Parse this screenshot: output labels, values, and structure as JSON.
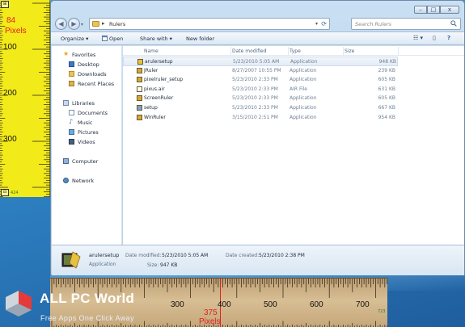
{
  "vertical_ruler": {
    "pixel_value": "84",
    "pixel_unit": "Pixels",
    "tick_labels": [
      "100",
      "200",
      "300"
    ],
    "bottom_readout": "424"
  },
  "window": {
    "address": {
      "path": "Rulers"
    },
    "search": {
      "placeholder": "Search Rulers"
    },
    "controls": {
      "minimize": "–",
      "maximize": "□",
      "close": "x"
    },
    "toolbar": {
      "organize": "Organize ▾",
      "open": "Open",
      "share_with": "Share with ▾",
      "new_folder": "New folder"
    },
    "nav_pane": {
      "favorites": "Favorites",
      "desktop": "Desktop",
      "downloads": "Downloads",
      "recent_places": "Recent Places",
      "libraries": "Libraries",
      "documents": "Documents",
      "music": "Music",
      "pictures": "Pictures",
      "videos": "Videos",
      "computer": "Computer",
      "network": "Network"
    },
    "columns": {
      "name": "Name",
      "date": "Date modified",
      "type": "Type",
      "size": "Size"
    },
    "files": [
      {
        "name": "arulersetup",
        "date": "5/23/2010 5:05 AM",
        "type": "Application",
        "size": "948 KB",
        "icon": "installer-icon"
      },
      {
        "name": "JRuler",
        "date": "8/27/2007 10:55 PM",
        "type": "Application",
        "size": "239 KB",
        "icon": "ruler-app-icon"
      },
      {
        "name": "pixelruler_setup",
        "date": "5/23/2010 2:33 PM",
        "type": "Application",
        "size": "605 KB",
        "icon": "ruler-app-icon"
      },
      {
        "name": "pixus.air",
        "date": "5/23/2010 2:33 PM",
        "type": "AIR File",
        "size": "631 KB",
        "icon": "air-file-icon"
      },
      {
        "name": "ScreenRuler",
        "date": "5/23/2010 2:33 PM",
        "type": "Application",
        "size": "605 KB",
        "icon": "ruler-app-icon"
      },
      {
        "name": "setup",
        "date": "5/23/2010 2:33 PM",
        "type": "Application",
        "size": "667 KB",
        "icon": "setup-icon"
      },
      {
        "name": "WinRuler",
        "date": "3/15/2010 2:51 PM",
        "type": "Application",
        "size": "954 KB",
        "icon": "ruler-app-icon"
      }
    ],
    "details": {
      "name": "arulersetup",
      "type": "Application",
      "modified_label": "Date modified:",
      "modified_value": "5/23/2010 5:05 AM",
      "created_label": "Date created:",
      "created_value": "5/23/2010 2:38 PM",
      "size_label": "Size:",
      "size_value": "947 KB"
    }
  },
  "horizontal_ruler": {
    "tick_labels": [
      "300",
      "400",
      "500",
      "600",
      "700"
    ],
    "pixel_value": "375",
    "pixel_unit": "Pixels",
    "right_readout": "723"
  },
  "watermark": {
    "brand": "ALL PC World",
    "tagline": "Free Apps One Click Away"
  }
}
